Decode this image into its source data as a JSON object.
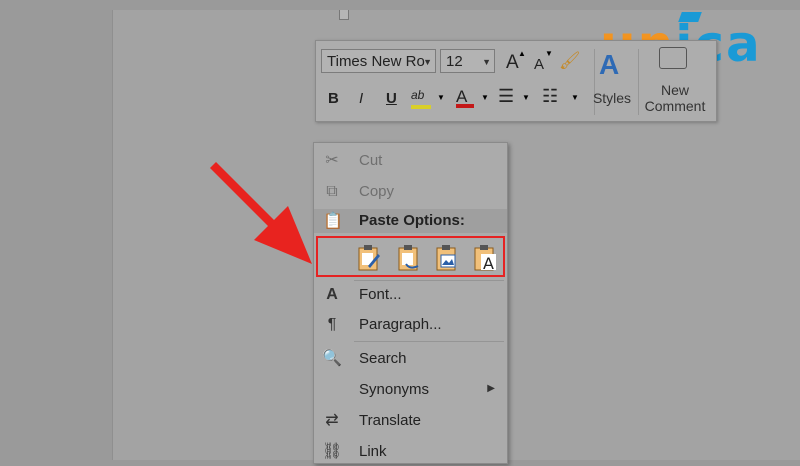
{
  "logo": {
    "l1": "u",
    "l2": "n",
    "l3": "i",
    "l4": "c",
    "l5": "a"
  },
  "toolbar": {
    "font_name": "Times New Ro",
    "font_size": "12",
    "styles_label": "Styles",
    "new_comment_line1": "New",
    "new_comment_line2": "Comment",
    "bold": "B",
    "italic": "I",
    "underline": "U",
    "grow_font": "A",
    "shrink_font": "A"
  },
  "menu": {
    "cut": "Cut",
    "copy": "Copy",
    "paste_options": "Paste Options:",
    "font": "Font...",
    "paragraph": "Paragraph...",
    "search": "Search",
    "synonyms": "Synonyms",
    "translate": "Translate",
    "link": "Link"
  },
  "colors": {
    "highlight_border": "#e52222",
    "arrow": "#e8231f",
    "logo_orange": "#f29421",
    "logo_blue": "#1a9ad6"
  }
}
